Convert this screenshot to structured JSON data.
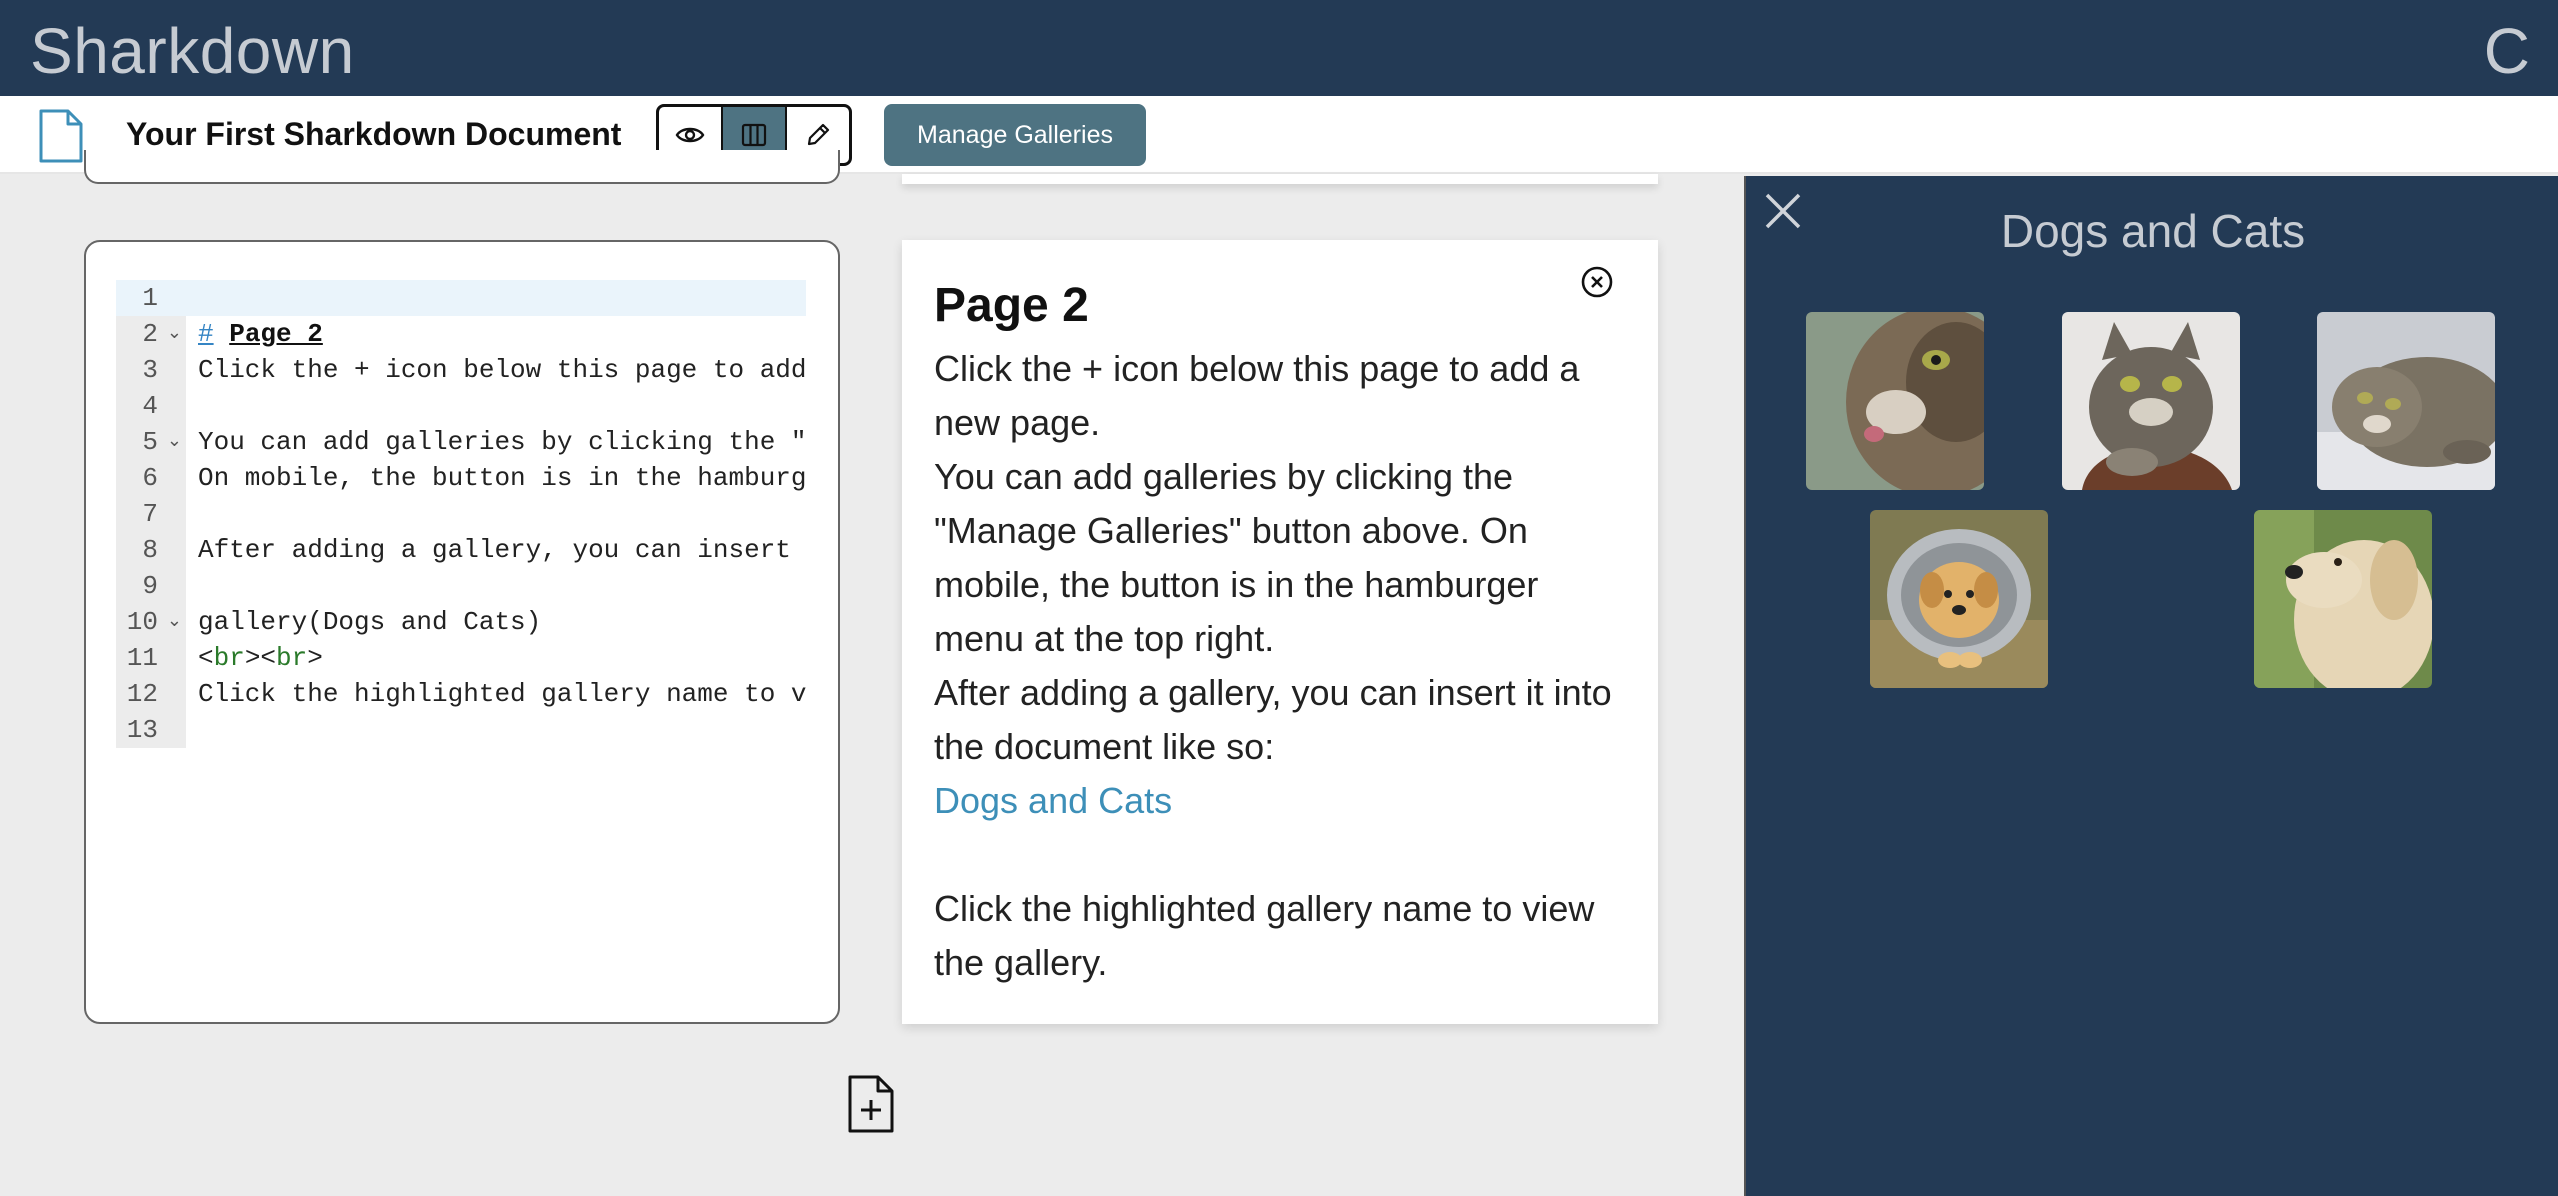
{
  "navbar": {
    "brand": "Sharkdown",
    "menu_glyph": "C"
  },
  "toolbar": {
    "doc_title": "Your First Sharkdown Document",
    "view_modes": [
      "preview",
      "split",
      "edit"
    ],
    "active_view": "split",
    "manage_label": "Manage Galleries"
  },
  "editor": {
    "lines": [
      {
        "n": "1",
        "text": ""
      },
      {
        "n": "2",
        "text": "# Page 2"
      },
      {
        "n": "3",
        "text": "Click the + icon below this page to add"
      },
      {
        "n": "4",
        "text": ""
      },
      {
        "n": "5",
        "text": "You can add galleries by clicking the \"M"
      },
      {
        "n": "6",
        "text": "On mobile, the button is in the hamburge"
      },
      {
        "n": "7",
        "text": ""
      },
      {
        "n": "8",
        "text": "After adding a gallery, you can insert i"
      },
      {
        "n": "9",
        "text": ""
      },
      {
        "n": "10",
        "text": "gallery(Dogs and Cats)"
      },
      {
        "n": "11",
        "text": "<br><br>"
      },
      {
        "n": "12",
        "text": "Click the highlighted gallery name to vi"
      },
      {
        "n": "13",
        "text": ""
      }
    ]
  },
  "preview": {
    "title": "Page 2",
    "p1": "Click the + icon below this page to add a new page.",
    "p2": "You can add galleries by clicking the \"Manage Galleries\" button above. On mobile, the button is in the hamburger menu at the top right.",
    "p3": "After adding a gallery, you can insert it into the document like so:",
    "link": "Dogs and Cats",
    "p4": "Click the highlighted gallery name to view the gallery."
  },
  "gallery": {
    "title": "Dogs and Cats",
    "images": [
      "cat-closeup",
      "tabby-cat-sitting",
      "cat-lying-down",
      "puppy-in-bucket",
      "golden-retriever"
    ]
  },
  "colors": {
    "nav": "#233a55",
    "accent": "#4e7382",
    "link": "#3d8fb8"
  }
}
